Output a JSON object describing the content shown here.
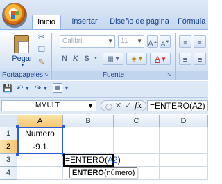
{
  "tabs": [
    {
      "label": "Inicio",
      "active": true
    },
    {
      "label": "Insertar",
      "active": false
    },
    {
      "label": "Diseño de página",
      "active": false
    },
    {
      "label": "Fórmula",
      "active": false
    }
  ],
  "ribbon": {
    "clipboard": {
      "paste_label": "Pegar",
      "group_label": "Portapapeles"
    },
    "font": {
      "font_name": "Calibri",
      "font_size": "11",
      "group_label": "Fuente",
      "bold": "N",
      "italic": "K",
      "underline": "S"
    }
  },
  "formula_bar": {
    "name_box": "MMULT",
    "fx_label": "fx",
    "formula": "=ENTERO(A2)"
  },
  "grid": {
    "columns": [
      "A",
      "B",
      "C",
      "D"
    ],
    "rows": [
      "1",
      "2",
      "3",
      "4"
    ],
    "cells": {
      "A1": "Numero",
      "A2": "-9.1",
      "B3_prefix": "=ENTERO(",
      "B3_ref": "A2",
      "B3_suffix": ")"
    },
    "tooltip": {
      "function": "ENTERO",
      "args": "(número)"
    }
  },
  "colors": {
    "accent": "#2e5cd6",
    "selected_header": "#f6c772",
    "ribbon": "#dce8f7"
  }
}
